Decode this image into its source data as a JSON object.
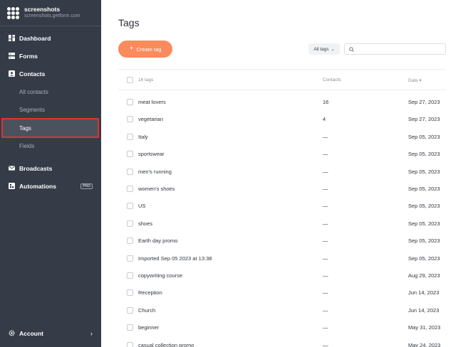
{
  "brand": {
    "name": "screenshots",
    "url": "screenshots.getform.com"
  },
  "sidebar": {
    "items": [
      {
        "label": "Dashboard",
        "icon": "dashboard-icon"
      },
      {
        "label": "Forms",
        "icon": "forms-icon"
      },
      {
        "label": "Contacts",
        "icon": "contacts-icon"
      }
    ],
    "subitems": [
      {
        "label": "All contacts"
      },
      {
        "label": "Segments"
      },
      {
        "label": "Tags",
        "active": true
      },
      {
        "label": "Fields"
      }
    ],
    "bottom_items": [
      {
        "label": "Broadcasts",
        "icon": "broadcasts-icon"
      },
      {
        "label": "Automations",
        "icon": "automations-icon",
        "badge": "PRO"
      }
    ],
    "account": {
      "label": "Account",
      "chevron": "›"
    }
  },
  "main": {
    "title": "Tags",
    "create_button": "Create tag",
    "filter": {
      "label": "All tags",
      "caret": "⌄"
    },
    "search": {
      "placeholder": ""
    },
    "table": {
      "headers": {
        "name": "16 tags",
        "contacts": "Contacts",
        "date": "Date ▾"
      },
      "rows": [
        {
          "name": "meat lovers",
          "contacts": "16",
          "date": "Sep 27, 2023"
        },
        {
          "name": "vegetarian",
          "contacts": "4",
          "date": "Sep 27, 2023"
        },
        {
          "name": "Italy",
          "contacts": "—",
          "date": "Sep 05, 2023"
        },
        {
          "name": "sportswear",
          "contacts": "—",
          "date": "Sep 05, 2023"
        },
        {
          "name": "men's running",
          "contacts": "—",
          "date": "Sep 05, 2023"
        },
        {
          "name": "women's shoes",
          "contacts": "—",
          "date": "Sep 05, 2023"
        },
        {
          "name": "US",
          "contacts": "—",
          "date": "Sep 05, 2023"
        },
        {
          "name": "shoes",
          "contacts": "—",
          "date": "Sep 05, 2023"
        },
        {
          "name": "Earth day promo",
          "contacts": "—",
          "date": "Sep 05, 2023"
        },
        {
          "name": "Imported Sep 05 2023 at 13:38",
          "contacts": "—",
          "date": "Sep 05, 2023"
        },
        {
          "name": "copywriting course",
          "contacts": "—",
          "date": "Aug 29, 2023"
        },
        {
          "name": "Reception",
          "contacts": "—",
          "date": "Jun 14, 2023"
        },
        {
          "name": "Church",
          "contacts": "—",
          "date": "Jun 14, 2023"
        },
        {
          "name": "beginner",
          "contacts": "—",
          "date": "May 31, 2023"
        },
        {
          "name": "casual collection promo",
          "contacts": "—",
          "date": "May 24, 2023"
        }
      ]
    }
  },
  "colors": {
    "sidebar_bg": "#363c47",
    "accent": "#fb8a5c",
    "highlight_border": "#e0322f"
  }
}
